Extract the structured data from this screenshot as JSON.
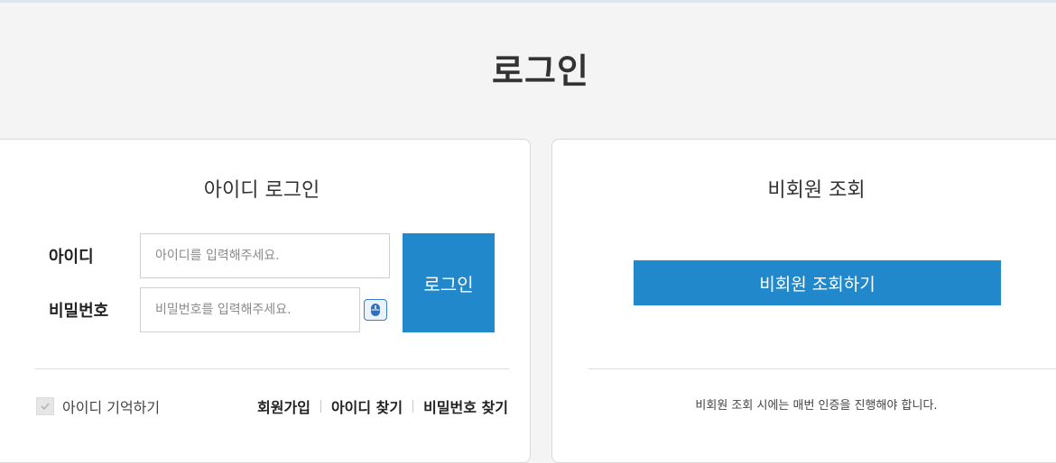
{
  "page": {
    "title": "로그인"
  },
  "member_login": {
    "title": "아이디 로그인",
    "id_label": "아이디",
    "id_placeholder": "아이디를 입력해주세요.",
    "id_value": "",
    "pw_label": "비밀번호",
    "pw_placeholder": "비밀번호를 입력해주세요.",
    "pw_value": "",
    "keypad_icon": "mouse-icon",
    "login_button": "로그인",
    "remember_label": "아이디 기억하기",
    "remember_checked": false,
    "links": {
      "join": "회원가입",
      "find_id": "아이디 찾기",
      "find_pw": "비밀번호 찾기"
    }
  },
  "guest_lookup": {
    "title": "비회원 조회",
    "button": "비회원 조회하기",
    "note": "비회원 조회 시에는 매번 인증을 진행해야 합니다."
  },
  "colors": {
    "accent": "#2188cc",
    "background": "#f4f4f4"
  }
}
